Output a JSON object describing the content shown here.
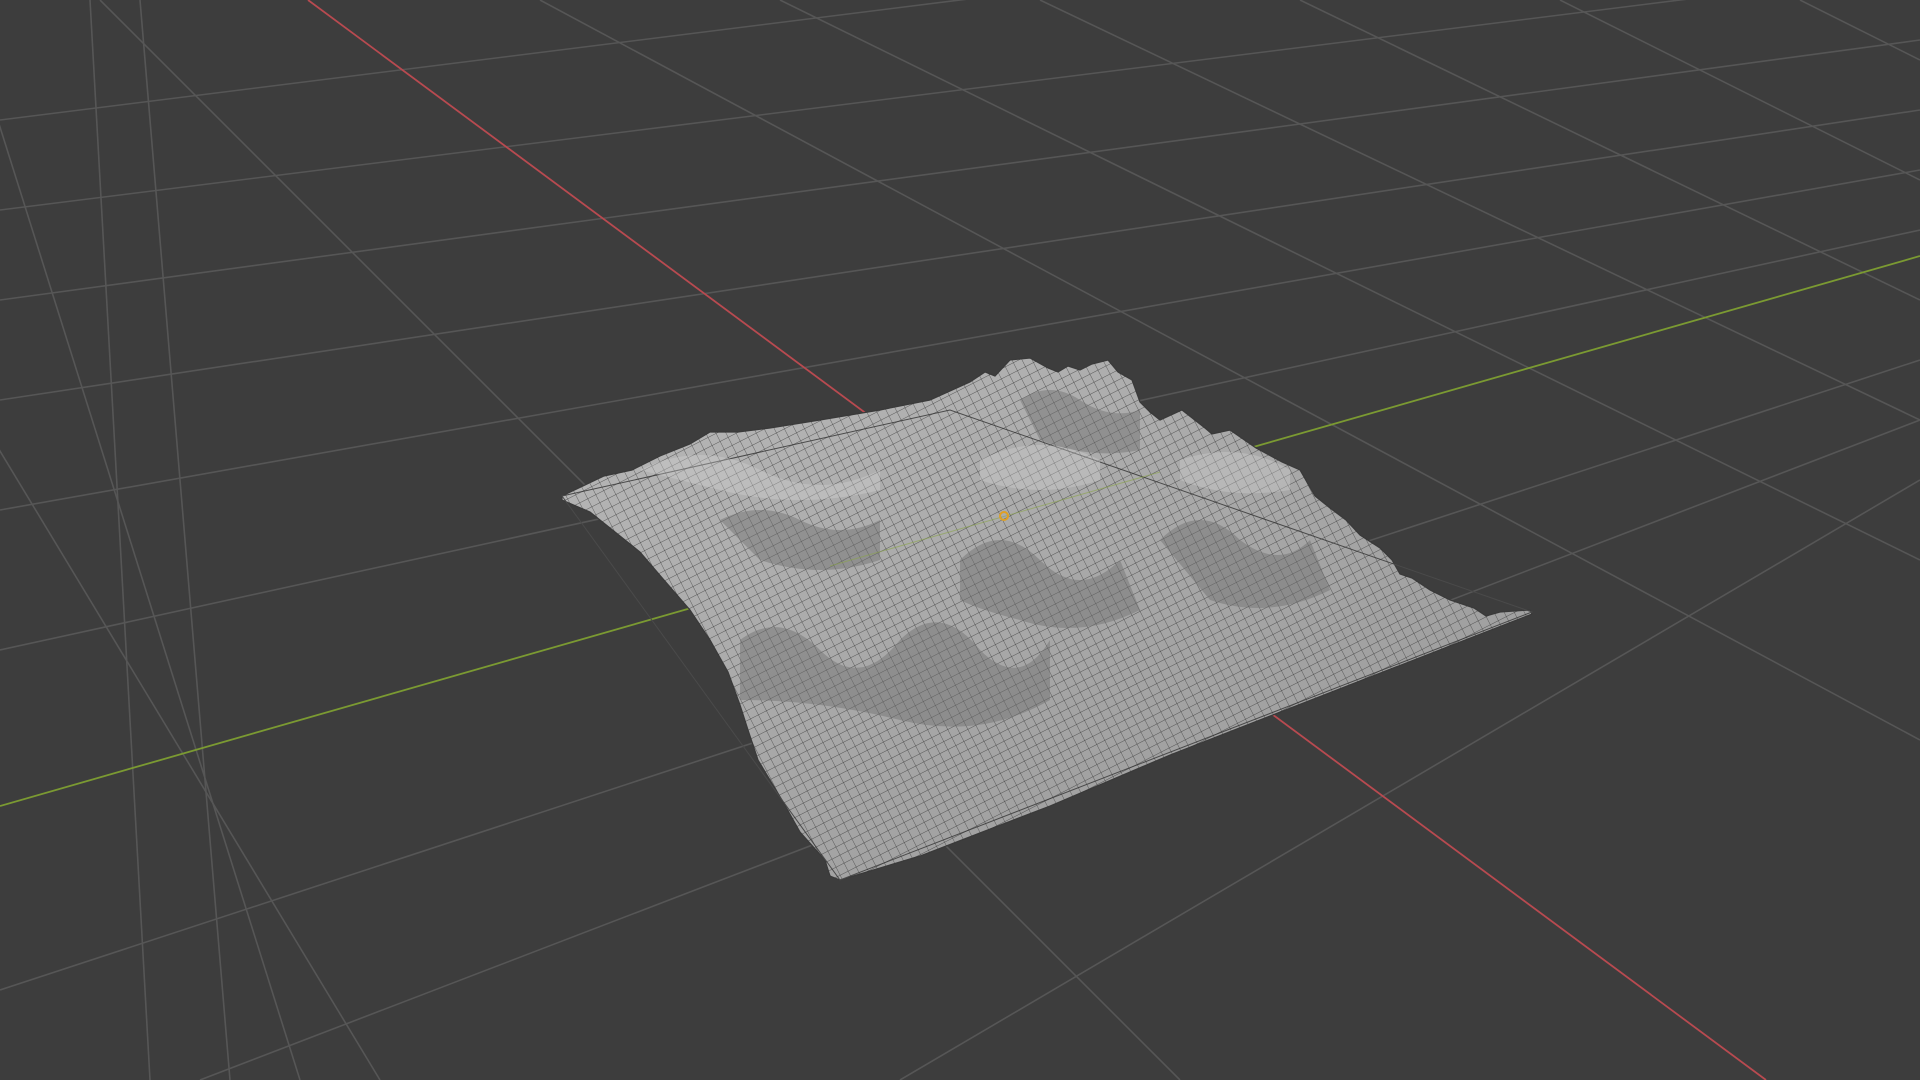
{
  "viewport": {
    "view": "3d-viewport",
    "background_color": "#3d3d3d",
    "grid_color": "#565656",
    "axis_x_color": "#b84a50",
    "axis_y_color": "#7b9a32",
    "grid_floor": true
  },
  "scene": {
    "objects": [
      {
        "name_icon": "terrain-mesh",
        "kind": "terrain-plane-with-displacement",
        "display": "solid-with-wireframe",
        "surface_color": "#a9a9a9",
        "wire_color": "#2c2c2c",
        "selected": false
      }
    ],
    "origin_marker_icon": "origin-dot-icon",
    "origin_marker_color": "#e0a020"
  }
}
